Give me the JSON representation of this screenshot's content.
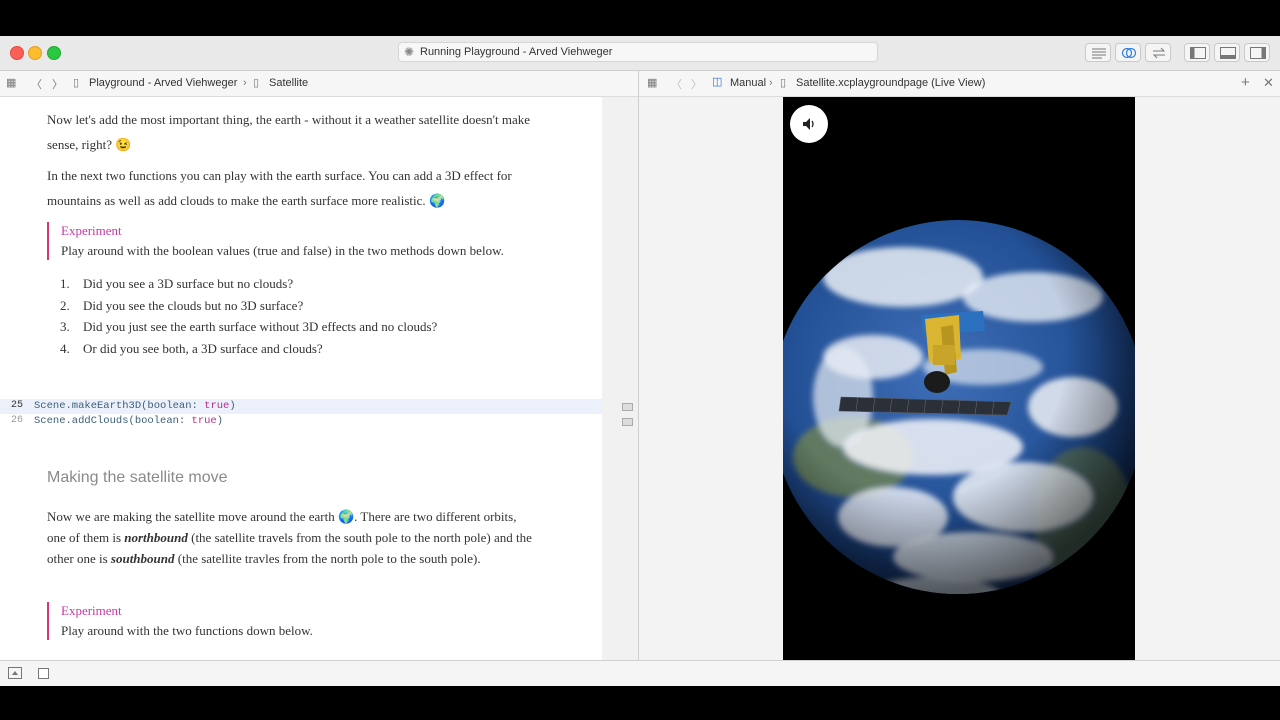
{
  "window": {
    "status": "Running Playground - Arved Viehweger"
  },
  "left_jumpbar": {
    "crumbs": [
      "Playground - Arved Viehweger",
      "Satellite"
    ]
  },
  "right_jumpbar": {
    "crumbs": [
      "Manual",
      "Satellite.xcplaygroundpage (Live View)"
    ]
  },
  "doc": {
    "p1_line1": "Now let's add the most important thing, the earth - without it a weather satellite doesn't make",
    "p1_line2": "sense, right?",
    "p1_emoji": "😉",
    "p2_line1": "In the next two functions you can play with the earth surface. You can add a 3D effect for",
    "p2_line2": "mountains as well as add clouds to make the earth surface more realistic.",
    "p2_emoji": "🌍",
    "experiment1": {
      "title": "Experiment",
      "body": "Play around with the boolean values (true and false) in the two methods down below."
    },
    "list": [
      {
        "num": "1.",
        "text": "Did you see a 3D surface but no clouds?"
      },
      {
        "num": "2.",
        "text": "Did you see the clouds but no 3D surface?"
      },
      {
        "num": "3.",
        "text": "Did you just see the earth surface without 3D effects and no clouds?"
      },
      {
        "num": "4.",
        "text": "Or did you see both, a 3D surface and clouds?"
      }
    ],
    "code": [
      {
        "line": "25",
        "call": "Scene.makeEarth3D(boolean: ",
        "value": "true",
        "end": ")"
      },
      {
        "line": "26",
        "call": "Scene.addClouds(boolean: ",
        "value": "true",
        "end": ")"
      }
    ],
    "heading": "Making the satellite move",
    "p3": {
      "a": "Now we are making the satellite move around the earth",
      "emoji": "🌍",
      "b": ". There are two different orbits,",
      "c": "one of them is",
      "north": "northbound",
      "d": "(the satellite travels from the south pole to the north pole) and the",
      "e": "other one is",
      "south": "southbound",
      "f": "(the satellite travles from the north pole to the south pole)."
    },
    "experiment2": {
      "title": "Experiment",
      "body": "Play around with the two functions down below."
    }
  },
  "icons": {
    "sound": "speaker-icon",
    "back": "chevron-left-icon",
    "forward": "chevron-right-icon"
  }
}
